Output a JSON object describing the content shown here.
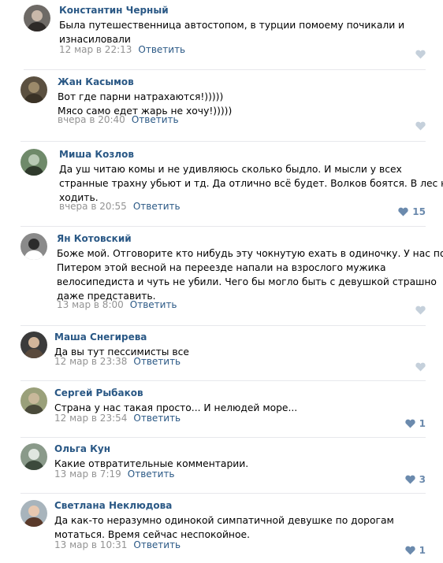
{
  "comments": [
    {
      "author": "Константин Черный",
      "text": [
        "Была путешественница автостопом, в турции помоему почикали и",
        "изнасиловали"
      ],
      "date": "12 мар в 22:13",
      "reply": "Ответить",
      "likes": ""
    },
    {
      "author": "Жан Касымов",
      "text": [
        "Вот где парни натрахаются!)))))",
        "Мясо само едет жарь не хочу!)))))"
      ],
      "date": "вчера в 20:40",
      "reply": "Ответить",
      "likes": ""
    },
    {
      "author": "Миша Козлов",
      "text": [
        "Да уш читаю комы и не удивляюсь сколько быдло. И мысли у всех",
        "странные трахну убьют и тд. Да отлично всё будет. Волков боятся. В лес не",
        "ходить."
      ],
      "date": "вчера в 20:55",
      "reply": "Ответить",
      "likes": "15"
    },
    {
      "author": "Ян Котовский",
      "text": [
        "Боже мой. Отговорите кто нибудь эту чокнутую ехать в одиночку. У нас под",
        "Питером этой весной на переезде напали на взрослого мужика",
        "велосипедиста и чуть не убили. Чего бы могло быть с девушкой страшно",
        "даже представить."
      ],
      "date": "13 мар в 8:00",
      "reply": "Ответить",
      "likes": ""
    },
    {
      "author": "Маша Снегирева",
      "text": [
        "Да вы тут пессимисты все"
      ],
      "date": "12 мар в 23:38",
      "reply": "Ответить",
      "likes": ""
    },
    {
      "author": "Сергей Рыбаков",
      "text": [
        "Страна у нас такая просто... И нелюдей море..."
      ],
      "date": "12 мар в 23:54",
      "reply": "Ответить",
      "likes": "1"
    },
    {
      "author": "Ольга Кун",
      "text": [
        "Какие отвратительные комментарии."
      ],
      "date": "13 мар в 7:19",
      "reply": "Ответить",
      "likes": "3"
    },
    {
      "author": "Светлана Неклюдова",
      "text": [
        "Да как-то неразумно одинокой симпатичной девушке по дорогам",
        "мотаться. Время сейчас неспокойное."
      ],
      "date": "13 мар в 10:31",
      "reply": "Ответить",
      "likes": "1"
    }
  ],
  "colors": {
    "author": "#2a5885",
    "meta": "#939393",
    "like_active": "#6b8aad",
    "like_inactive": "#c5d0db",
    "divider": "#e7e8ec"
  }
}
